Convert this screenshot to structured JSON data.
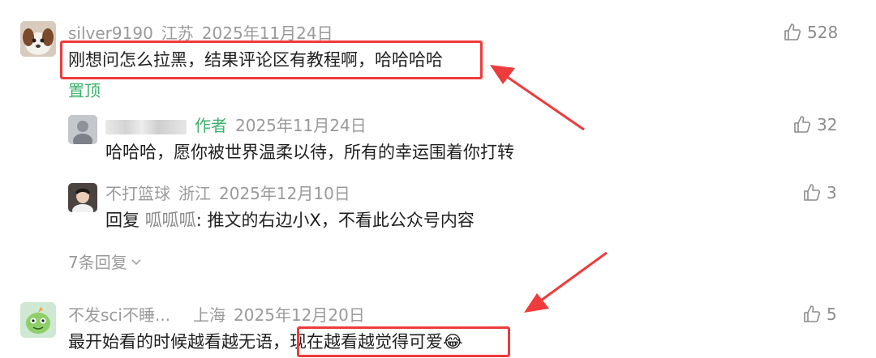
{
  "comments": [
    {
      "username": "silver9190",
      "location": "江苏",
      "date": "2025年11月24日",
      "text": "刚想问怎么拉黑，结果评论区有教程啊，哈哈哈哈",
      "likes": "528",
      "pinned_label": "置顶",
      "replies": [
        {
          "username": "",
          "author_tag": "作者",
          "date": "2025年11月24日",
          "text": "哈哈哈，愿你被世界温柔以待，所有的幸运围着你打转",
          "likes": "32"
        },
        {
          "username": "不打篮球",
          "location": "浙江",
          "date": "2025年12月10日",
          "reply_prefix": "回复",
          "reply_to": "呱呱呱",
          "text": ": 推文的右边小X，不看此公众号内容",
          "likes": "3"
        }
      ],
      "more_replies_label": "7条回复"
    },
    {
      "username": "不发sci不睡...",
      "location": "上海",
      "date": "2025年12月20日",
      "text_part1": "最开始看的时候越看越无语，",
      "text_part2": "现在越看越觉得可爱",
      "emoji": "😂",
      "likes": "5"
    }
  ],
  "icons": {
    "like": "thumbs-up-icon",
    "expand": "chevron-down-icon"
  },
  "colors": {
    "author_tag": "#3cb16a",
    "pinned": "#3cb16a",
    "annotation": "#ee3b3b",
    "meta": "#9a9a9a"
  }
}
